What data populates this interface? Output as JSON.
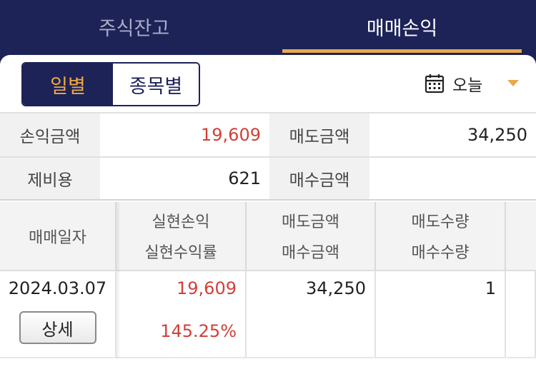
{
  "tabs": [
    {
      "label": "주식잔고",
      "active": false
    },
    {
      "label": "매매손익",
      "active": true
    }
  ],
  "segment": {
    "options": [
      {
        "label": "일별",
        "active": true
      },
      {
        "label": "종목별",
        "active": false
      }
    ]
  },
  "date_picker": {
    "value": "오늘",
    "icon": "calendar-icon"
  },
  "summary": {
    "profit_label": "손익금액",
    "profit_value": "19,609",
    "sell_amount_label": "매도금액",
    "sell_amount_value": "34,250",
    "fee_label": "제비용",
    "fee_value": "621",
    "buy_amount_label": "매수금액",
    "buy_amount_value": ""
  },
  "table": {
    "headers": {
      "date": "매매일자",
      "realized_pl": "실현손익",
      "realized_rate": "실현수익률",
      "sell_amount": "매도금액",
      "buy_amount": "매수금액",
      "sell_qty": "매도수량",
      "buy_qty": "매수수량"
    },
    "rows": [
      {
        "date": "2024.03.07",
        "detail_label": "상세",
        "realized_pl": "19,609",
        "realized_rate": "145.25%",
        "sell_amount": "34,250",
        "buy_amount": "",
        "sell_qty": "1",
        "buy_qty": ""
      }
    ]
  },
  "colors": {
    "header_bg": "#1d2257",
    "accent": "#e8a84b",
    "profit": "#d1403a"
  }
}
